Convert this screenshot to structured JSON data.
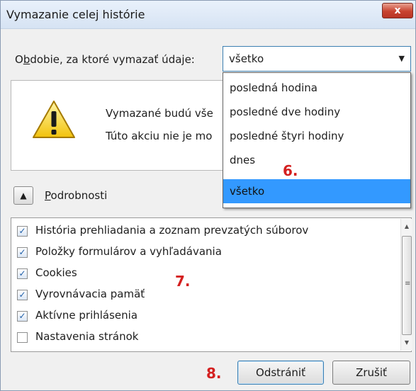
{
  "dialog": {
    "title": "Vymazanie celej histórie",
    "close_label": "x"
  },
  "period": {
    "label_pre": "O",
    "label_underlined": "b",
    "label_post": "dobie, za ktoré vymazať údaje:",
    "selected": "všetko",
    "options": [
      "posledná hodina",
      "posledné dve hodiny",
      "posledné štyri hodiny",
      "dnes",
      "všetko"
    ]
  },
  "info": {
    "line1": "Vymazané budú vše",
    "line2": "Túto akciu nie je mo"
  },
  "details": {
    "underlined": "P",
    "rest": "odrobnosti"
  },
  "items": [
    {
      "label": "História prehliadania a zoznam prevzatých súborov",
      "checked": true
    },
    {
      "label": "Položky formulárov a vyhľadávania",
      "checked": true
    },
    {
      "label": "Cookies",
      "checked": true
    },
    {
      "label": "Vyrovnávacia pamäť",
      "checked": true
    },
    {
      "label": "Aktívne prihlásenia",
      "checked": true
    },
    {
      "label": "Nastavenia stránok",
      "checked": false
    }
  ],
  "buttons": {
    "delete": "Odstrániť",
    "cancel": "Zrušiť"
  },
  "markers": {
    "m6": "6.",
    "m7": "7.",
    "m8": "8."
  },
  "icons": {
    "warning": "warning-icon",
    "close": "close-icon",
    "dropdown": "chevron-down-icon",
    "expand": "chevron-up-icon",
    "check": "checkmark-icon"
  },
  "colors": {
    "selection": "#3399ff",
    "marker": "#d42020",
    "close_button": "#c8432f"
  }
}
